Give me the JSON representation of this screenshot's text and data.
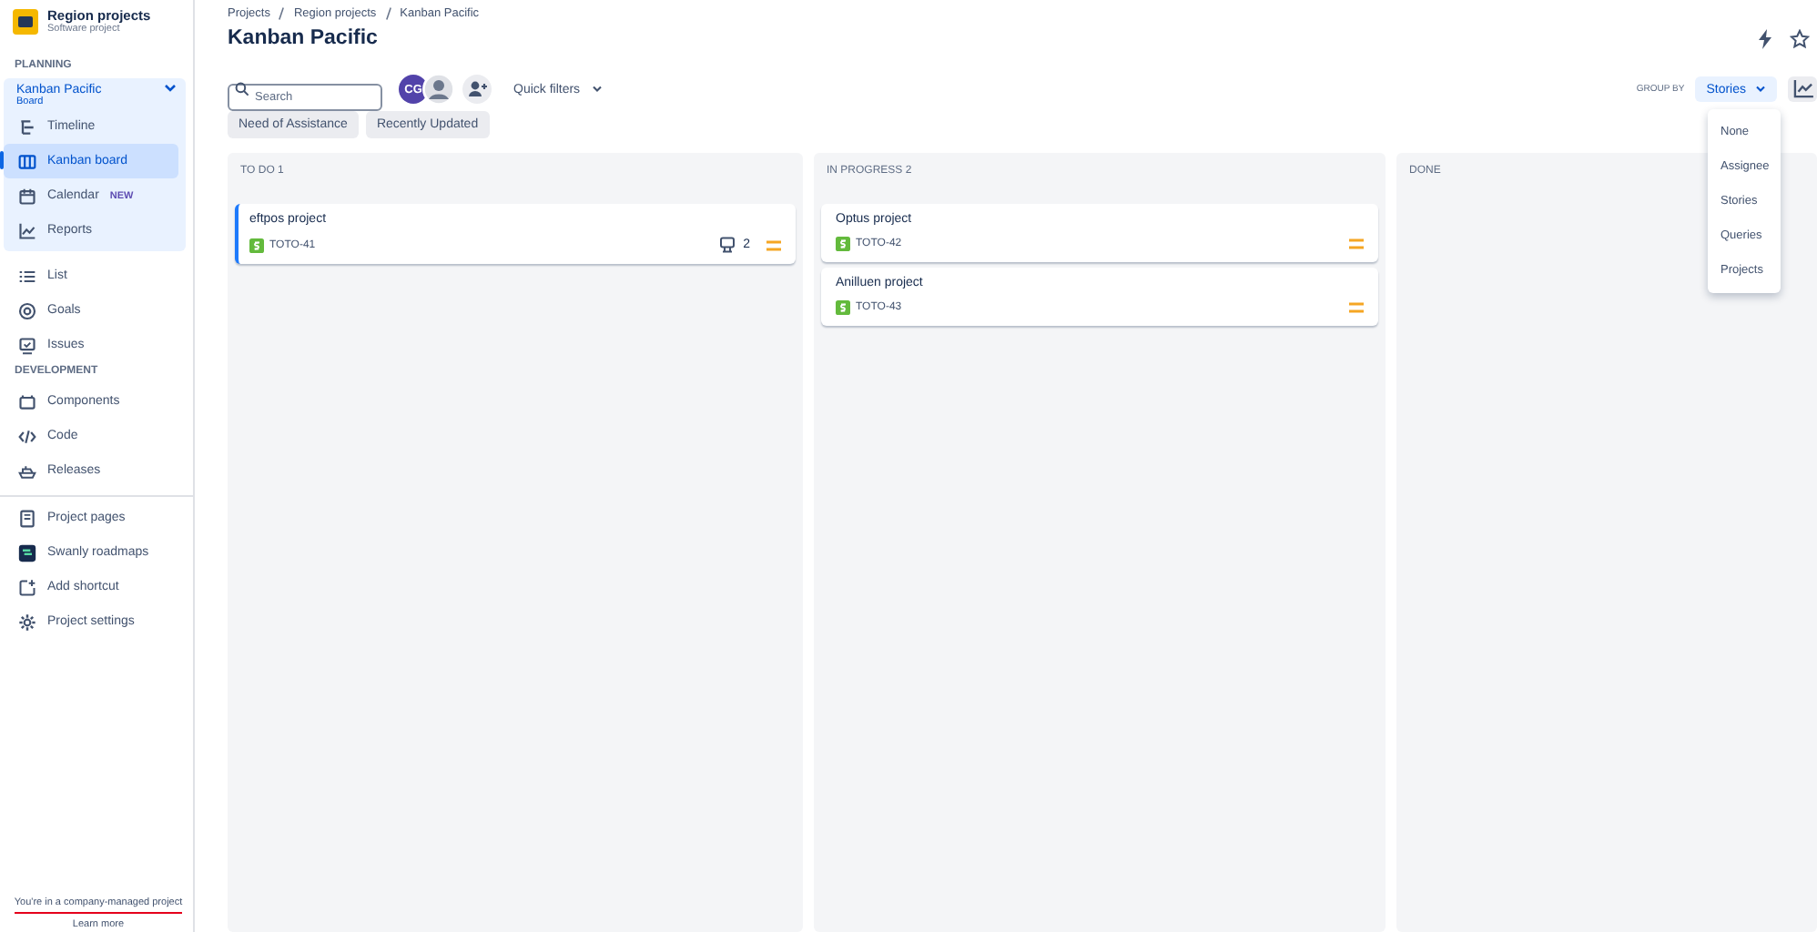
{
  "project": {
    "name": "Region projects",
    "type": "Software project"
  },
  "sidebar": {
    "planning": {
      "heading": "PLANNING",
      "board_name": "Kanban Pacific",
      "board_type": "Board",
      "items": [
        {
          "label": "Timeline",
          "selected": false
        },
        {
          "label": "Kanban board",
          "selected": true
        },
        {
          "label": "Calendar",
          "selected": false,
          "badge": "NEW"
        },
        {
          "label": "Reports",
          "selected": false
        }
      ]
    },
    "items": [
      {
        "label": "List",
        "selected": false
      },
      {
        "label": "Goals",
        "selected": false
      },
      {
        "label": "Issues",
        "selected": false
      }
    ],
    "development": {
      "heading": "DEVELOPMENT",
      "items": [
        {
          "label": "Components",
          "selected": false
        },
        {
          "label": "Code",
          "selected": false
        },
        {
          "label": "Releases",
          "selected": false
        }
      ]
    },
    "extras": [
      {
        "label": "Project pages",
        "selected": false
      },
      {
        "label": "Swanly roadmaps",
        "selected": false
      },
      {
        "label": "Add shortcut",
        "selected": false
      },
      {
        "label": "Project settings",
        "selected": false
      }
    ],
    "footer": {
      "notice": "You're in a company-managed project",
      "link": "Learn more"
    }
  },
  "breadcrumbs": [
    "Projects",
    "Region projects",
    "Kanban Pacific"
  ],
  "title": "Kanban Pacific",
  "toolbar": {
    "search": {
      "placeholder": "Search"
    },
    "avatar_initials": "CG",
    "quick_filters": "Quick filters",
    "group_by_label": "GROUP BY",
    "group_by_value": "Stories",
    "chips": [
      "Need of Assistance",
      "Recently Updated"
    ]
  },
  "group_menu": [
    "None",
    "Assignee",
    "Stories",
    "Queries",
    "Projects"
  ],
  "columns": [
    {
      "title": "TO DO 1",
      "cards": [
        {
          "title": "eftpos project",
          "key": "TOTO-41",
          "subtasks": "2",
          "selected": true
        }
      ]
    },
    {
      "title": "IN PROGRESS 2",
      "cards": [
        {
          "title": "Optus project",
          "key": "TOTO-42",
          "selected": false
        },
        {
          "title": "Anilluen project",
          "key": "TOTO-43",
          "selected": false
        }
      ]
    },
    {
      "title": "DONE"
    }
  ]
}
